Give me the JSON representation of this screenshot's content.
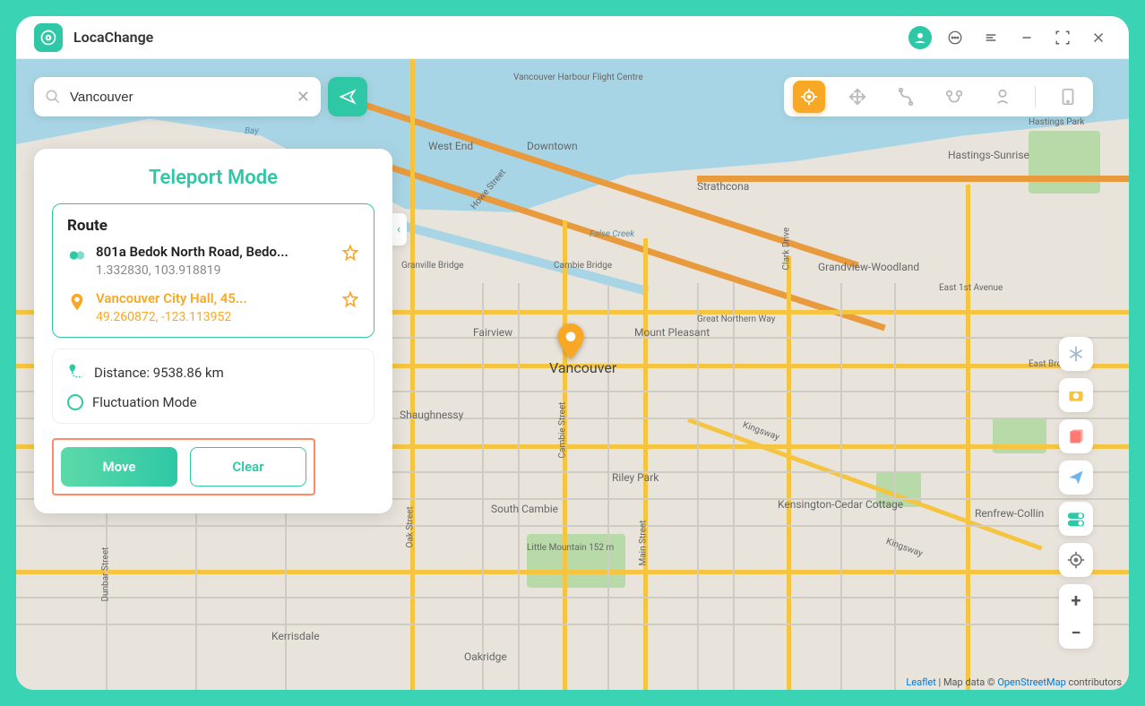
{
  "app": {
    "title": "LocaChange"
  },
  "search": {
    "value": "Vancouver"
  },
  "panel": {
    "title": "Teleport Mode",
    "route_title": "Route",
    "origin": {
      "name": "801a Bedok North Road, Bedo...",
      "coords": "1.332830, 103.918819"
    },
    "destination": {
      "name": "Vancouver City Hall, 45...",
      "coords": "49.260872, -123.113952"
    },
    "distance_label": "Distance: 9538.86 km",
    "fluctuation_label": "Fluctuation Mode",
    "move_label": "Move",
    "clear_label": "Clear"
  },
  "map": {
    "pin_city": "Vancouver",
    "labels": {
      "westend": "West End",
      "downtown": "Downtown",
      "harbour": "Vancouver Harbour Flight Centre",
      "strathcona": "Strathcona",
      "hastings": "Hastings-Sunrise",
      "hastingspark": "Hastings Park",
      "falsecreek": "False Creek",
      "granville": "Granville Bridge",
      "cambie": "Cambie Bridge",
      "fairview": "Fairview",
      "mtpleasant": "Mount Pleasant",
      "grandview": "Grandview-Woodland",
      "e1st": "East 1st Avenue",
      "gnw": "Great Northern Way",
      "shaughnessy": "Shaughnessy",
      "rileypark": "Riley Park",
      "scambie": "South Cambie",
      "kensington": "Kensington-Cedar Cottage",
      "renfrew": "Renfrew-Collin",
      "littlemtn": "Little Mountain 152 m",
      "kerrisdale": "Kerrisdale",
      "oakridge": "Oakridge",
      "ebroad": "East Broad",
      "kingsway1": "Kingsway",
      "kingsway2": "Kingsway",
      "clark": "Clark Drive",
      "oak": "Oak Street",
      "main": "Main Street",
      "cambiest": "Cambie Street",
      "dunbar": "Dunbar Street",
      "bay": "Bay",
      "howe": "Howe Street"
    },
    "attribution": {
      "leaflet": "Leaflet",
      "mid": " | Map data © ",
      "osm": "OpenStreetMap",
      "tail": " contributors"
    }
  }
}
